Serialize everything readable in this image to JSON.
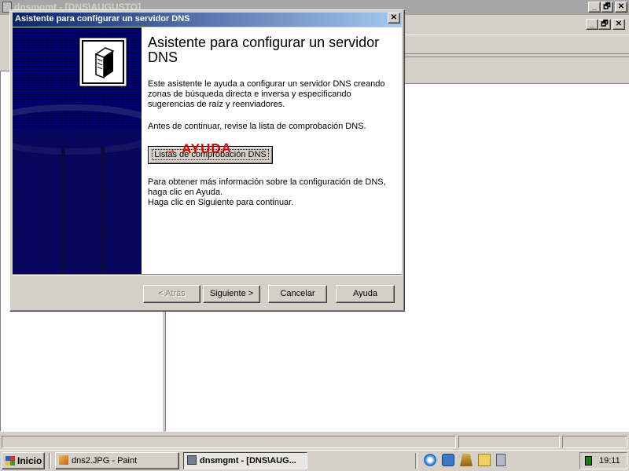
{
  "main_window": {
    "title": "dnsmgmt - [DNS\\AUGUSTO]",
    "min_label": "_",
    "restore_label": "🗗",
    "close_label": "✕"
  },
  "dialog": {
    "title": "Asistente para configurar un servidor DNS",
    "close_label": "✕",
    "heading": "Asistente para configurar un servidor DNS",
    "intro": "Este asistente le ayuda a configurar un servidor DNS creando zonas de búsqueda directa e inversa y especificando sugerencias de raíz y reenviadores.",
    "checklist_note": "Antes de continuar, revise la lista de comprobación DNS.",
    "checklist_button": "Listas de comprobación DNS",
    "annotation": "→ AYUDA",
    "info_line1": "Para obtener más información sobre la configuración de DNS, haga clic en Ayuda.",
    "info_line2": "Haga clic en Siguiente para continuar.",
    "buttons": {
      "back": "< Atrás",
      "next": "Siguiente >",
      "cancel": "Cancelar",
      "help": "Ayuda"
    }
  },
  "taskbar": {
    "start": "Inicio",
    "tasks": [
      "dns2.JPG - Paint",
      "dnsmgmt - [DNS\\AUG..."
    ],
    "clock": "19:11"
  },
  "icons": [
    "server-icon",
    "paint-icon",
    "dns-console-icon",
    "ie-icon",
    "outlook-icon",
    "recycle-icon",
    "folder-icon",
    "calculator-icon",
    "windows-logo-icon"
  ],
  "colors": {
    "title_active_start": "#0a246a",
    "title_active_end": "#a6caf0",
    "banner": "#000080",
    "annotation": "#e00000"
  }
}
